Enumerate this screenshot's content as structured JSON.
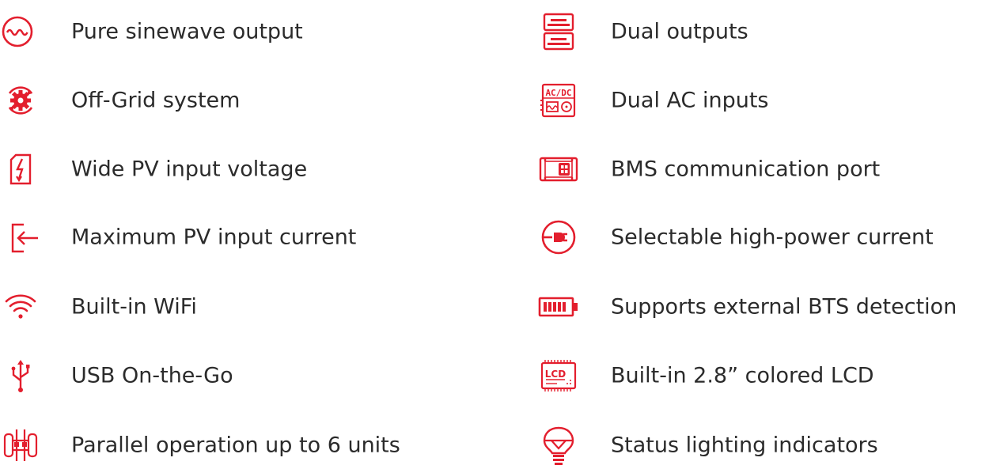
{
  "accent_color": "#e31e2d",
  "text_color": "#2b2b2b",
  "left_features": [
    {
      "label": "Pure sinewave output",
      "icon": "sinewave-icon"
    },
    {
      "label": "Off-Grid system",
      "icon": "gear-cycle-icon"
    },
    {
      "label": "Wide PV input voltage",
      "icon": "lightning-panel-icon"
    },
    {
      "label": "Maximum PV input current",
      "icon": "arrow-in-icon"
    },
    {
      "label": "Built-in WiFi",
      "icon": "wifi-icon"
    },
    {
      "label": "USB On-the-Go",
      "icon": "usb-icon"
    },
    {
      "label": "Parallel operation up to 6 units",
      "icon": "parallel-network-icon"
    }
  ],
  "right_features": [
    {
      "label": "Dual outputs",
      "icon": "dual-output-icon"
    },
    {
      "label": "Dual AC inputs",
      "icon": "ac-dc-icon",
      "icon_text": "AC/DC"
    },
    {
      "label": "BMS communication port",
      "icon": "bms-port-icon"
    },
    {
      "label": "Selectable high-power current",
      "icon": "plug-icon"
    },
    {
      "label": "Supports external BTS detection",
      "icon": "battery-icon"
    },
    {
      "label": "Built-in 2.8” colored LCD",
      "icon": "lcd-icon",
      "icon_text": "LCD"
    },
    {
      "label": "Status lighting indicators",
      "icon": "lightbulb-icon"
    }
  ]
}
